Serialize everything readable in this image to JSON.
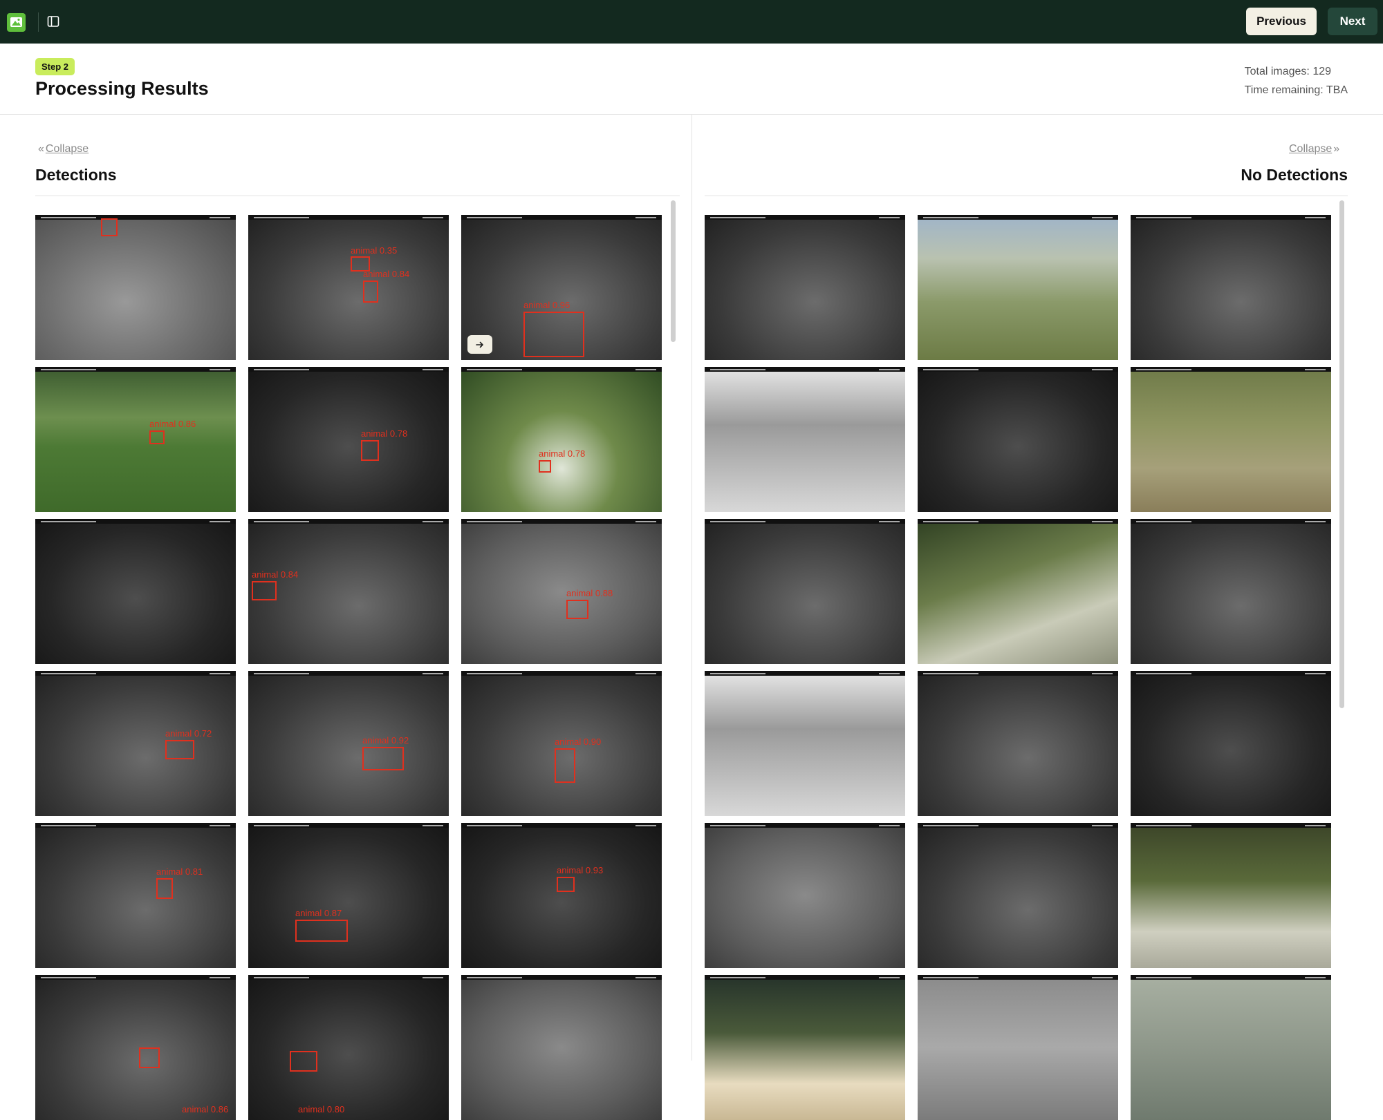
{
  "topbar": {
    "previous_label": "Previous",
    "next_label": "Next"
  },
  "header": {
    "step_badge": "Step 2",
    "title": "Processing Results",
    "total_images": "Total images: 129",
    "time_remaining": "Time remaining: TBA"
  },
  "left_panel": {
    "collapse_label": "Collapse",
    "title": "Detections",
    "thumbnails": [
      {
        "bg": "bg-n4",
        "detections": [
          {
            "label": ""
          }
        ]
      },
      {
        "bg": "bg-n1",
        "detections": [
          {
            "label": "animal 0.35"
          },
          {
            "label": "animal 0.84"
          }
        ]
      },
      {
        "bg": "bg-n1",
        "detections": [
          {
            "label": "animal 0.96"
          }
        ]
      },
      {
        "bg": "bg-d1",
        "detections": [
          {
            "label": "animal 0.86"
          }
        ]
      },
      {
        "bg": "bg-n2",
        "detections": [
          {
            "label": "animal 0.78"
          }
        ]
      },
      {
        "bg": "bg-d2",
        "detections": [
          {
            "label": "animal 0.78"
          }
        ]
      },
      {
        "bg": "bg-n2",
        "detections": []
      },
      {
        "bg": "bg-n1",
        "detections": [
          {
            "label": "animal 0.84"
          }
        ]
      },
      {
        "bg": "bg-n3",
        "detections": [
          {
            "label": "animal 0.88"
          }
        ]
      },
      {
        "bg": "bg-n1",
        "detections": [
          {
            "label": "animal 0.72"
          }
        ]
      },
      {
        "bg": "bg-n1",
        "detections": [
          {
            "label": "animal 0.92"
          }
        ]
      },
      {
        "bg": "bg-n1",
        "detections": [
          {
            "label": "animal 0.90"
          }
        ]
      },
      {
        "bg": "bg-n1",
        "detections": [
          {
            "label": "animal 0.81"
          }
        ]
      },
      {
        "bg": "bg-n2",
        "detections": [
          {
            "label": "animal 0.87"
          }
        ]
      },
      {
        "bg": "bg-n2",
        "detections": [
          {
            "label": "animal 0.93"
          }
        ]
      },
      {
        "bg": "bg-n1",
        "detections": [
          {
            "label": "animal 0.86"
          }
        ]
      },
      {
        "bg": "bg-n2",
        "detections": [
          {
            "label": "animal 0.80"
          }
        ]
      },
      {
        "bg": "bg-n3",
        "detections": []
      }
    ]
  },
  "right_panel": {
    "collapse_label": "Collapse",
    "title": "No Detections",
    "thumbnails": [
      {
        "bg": "bg-n1"
      },
      {
        "bg": "bg-d3"
      },
      {
        "bg": "bg-n1"
      },
      {
        "bg": "bg-w1"
      },
      {
        "bg": "bg-n2"
      },
      {
        "bg": "bg-d4"
      },
      {
        "bg": "bg-n1"
      },
      {
        "bg": "bg-d5"
      },
      {
        "bg": "bg-n1"
      },
      {
        "bg": "bg-w1"
      },
      {
        "bg": "bg-n1"
      },
      {
        "bg": "bg-n2"
      },
      {
        "bg": "bg-n3"
      },
      {
        "bg": "bg-n1"
      },
      {
        "bg": "bg-d6"
      },
      {
        "bg": "bg-w2"
      },
      {
        "bg": "bg-w3"
      },
      {
        "bg": "bg-w4"
      }
    ]
  },
  "colors": {
    "topbar": "#13291f",
    "accent_badge": "#c9ec5c",
    "detection_red": "#e0301e",
    "next_button": "#24473a",
    "previous_button": "#f3f0e4"
  },
  "icons": [
    "app-logo-icon",
    "sidebar-toggle-icon",
    "chevrons-left-icon",
    "chevrons-right-icon",
    "arrow-right-icon"
  ]
}
